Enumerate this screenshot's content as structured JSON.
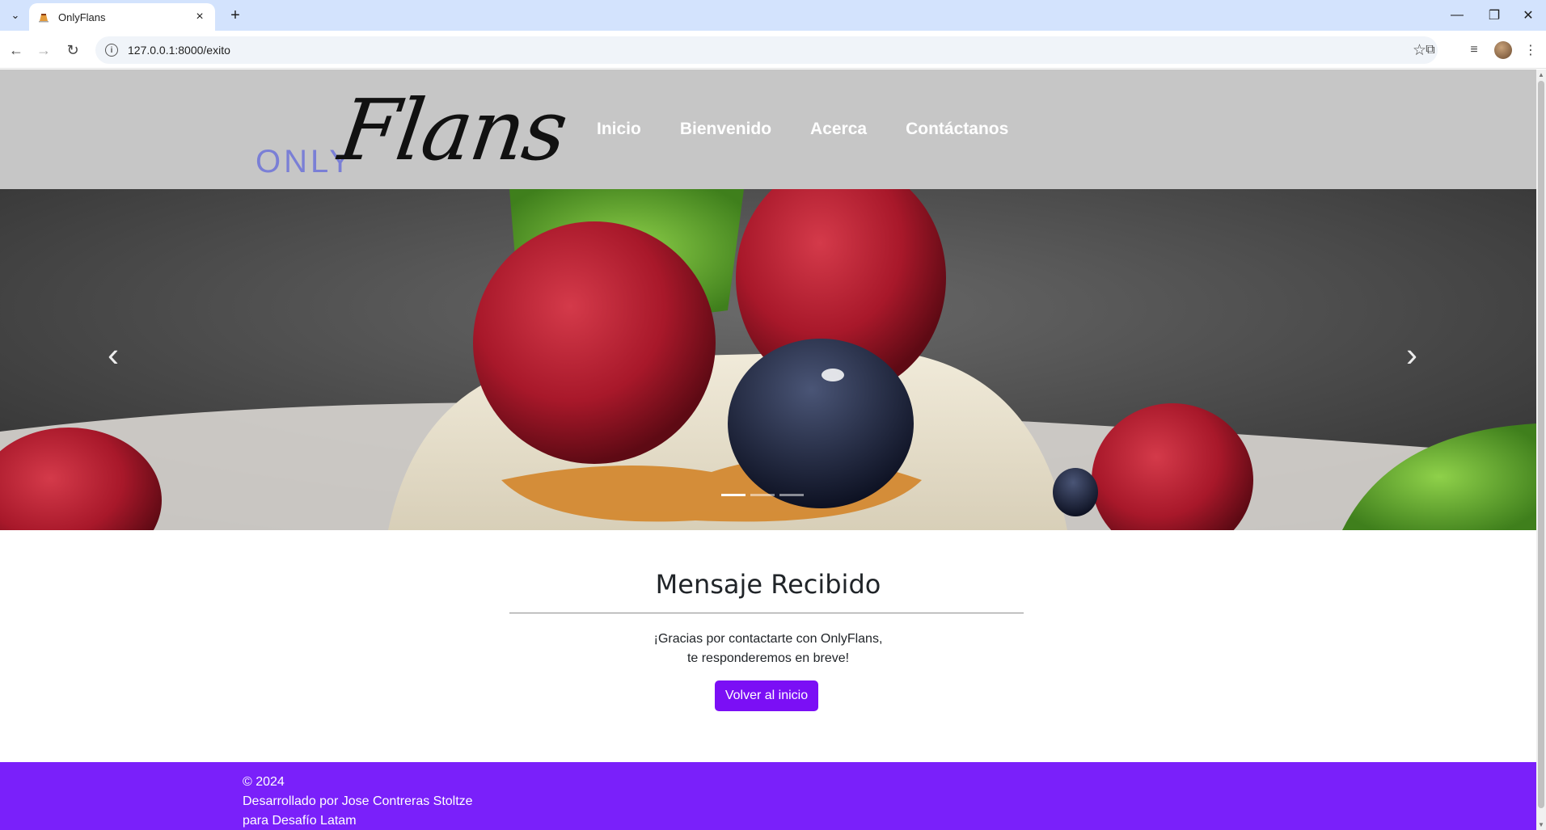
{
  "browser": {
    "tab_title": "OnlyFlans",
    "url": "127.0.0.1:8000/exito"
  },
  "header": {
    "logo_only": "ONLY",
    "logo_flans": "Flans",
    "nav": [
      "Inicio",
      "Bienvenido",
      "Acerca",
      "Contáctanos"
    ]
  },
  "carousel": {
    "slides": 3,
    "active_slide": 1
  },
  "main": {
    "title": "Mensaje Recibido",
    "line1": "¡Gracias por contactarte con OnlyFlans,",
    "line2": "te responderemos en breve!",
    "button": "Volver al inicio"
  },
  "footer": {
    "copyright": "© 2024",
    "developer": "Desarrollado por Jose Contreras Stoltze",
    "sponsor": "para Desafío Latam"
  },
  "colors": {
    "header_bg": "#c6c6c6",
    "accent_purple": "#7a20fa",
    "logo_only": "#7a7fd6"
  }
}
